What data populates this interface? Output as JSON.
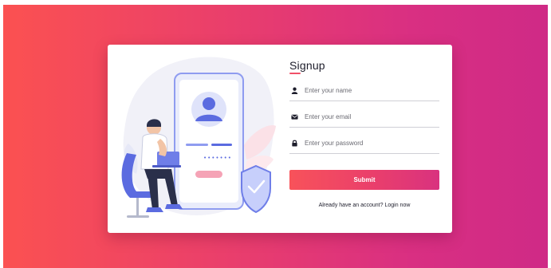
{
  "form": {
    "title": "Signup",
    "fields": [
      {
        "icon": "user-icon",
        "placeholder": "Enter your name",
        "value": ""
      },
      {
        "icon": "envelope-icon",
        "placeholder": "Enter your email",
        "value": ""
      },
      {
        "icon": "lock-icon",
        "placeholder": "Enter your password",
        "value": ""
      }
    ],
    "submit_label": "Submit",
    "login_prompt": "Already have an account?",
    "login_link": "Login now"
  },
  "illustration": {
    "icon": "signup-illustration-icon",
    "password_mask": "•••••••"
  },
  "colors": {
    "gradient_start": "#fb5151",
    "gradient_end": "#cf2a86",
    "accent_blue": "#5b6be0",
    "accent_pink": "#f5a3b6"
  }
}
